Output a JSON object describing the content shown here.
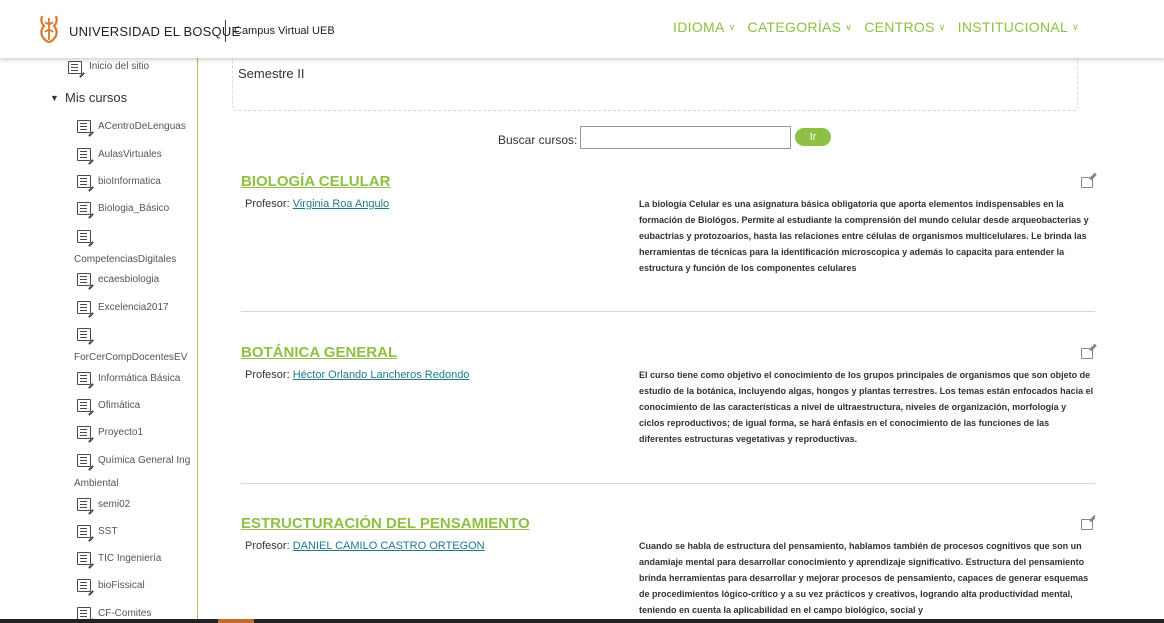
{
  "header": {
    "university": "UNIVERSIDAD EL BOSQUE",
    "campus": "Campus Virtual UEB",
    "nav": [
      "IDIOMA",
      "CATEGORÍAS",
      "CENTROS",
      "INSTITUCIONAL"
    ],
    "accent_color": "#8dc043"
  },
  "sidebar": {
    "top_item": "Inicio del sitio",
    "section": "Mis cursos",
    "courses": [
      "ACentroDeLenguas",
      "AulasVirtuales",
      "bioInformatica",
      "Biologia_Básico",
      "CompetenciasDigitales",
      "ecaesbiologia",
      "Excelencia2017",
      "ForCerCompDocentesEV",
      "Informática Básica",
      "Ofimática",
      "Proyecto1",
      "Química General Ing",
      "Ambiental",
      "semi02",
      "SST",
      "TIC Ingeniería",
      "bioFissical",
      "CF-Comites"
    ]
  },
  "main": {
    "semestre": "Semestre II",
    "search_label": "Buscar cursos:",
    "search_button": "Ir",
    "courses": [
      {
        "title": "BIOLOGÍA CELULAR",
        "prof_label": "Profesor:",
        "prof_name": "Virginia Roa Angulo",
        "description": "La biología Celular es una asignatura básica obligatoria que aporta elementos indispensables en la formación de Biológos. Permite al estudiante la comprensión del mundo celular desde arqueobacterias y eubactrias y protozoarios, hasta las relaciones entre células de organismos multicelulares. Le brinda las herramientas de técnicas para la identificación microscopica y además lo capacita para entender la estructura y función de los componentes celulares"
      },
      {
        "title": "BOTÁNICA GENERAL",
        "prof_label": "Profesor:",
        "prof_name": "Héctor Orlando Lancheros Redondo",
        "description": "El curso tiene como objetivo el conocimiento de los grupos principales de organismos que son objeto de estudio de la botánica, incluyendo algas, hongos y plantas terrestres. Los temas están enfocados hacia el conocimiento de las características a nivel de ultraestructura, niveles de organización, morfología y ciclos reproductivos; de igual forma, se hará énfasis en el conocimiento de las funciones de las diferentes estructuras vegetativas y reproductivas."
      },
      {
        "title": "ESTRUCTURACIÓN DEL PENSAMIENTO",
        "prof_label": "Profesor:",
        "prof_name": "DANIEL CAMILO CASTRO ORTEGON",
        "description": "Cuando se habla de estructura del pensamiento, hablamos también de procesos cognitivos que son un andamiaje mental para desarrollar conocimiento y aprendizaje significativo.  Estructura del pensamiento brinda herramientas para desarrollar y mejorar procesos de pensamiento, capaces de  generar esquemas de procedimientos lógico-crítico y a su vez prácticos y creativos, logrando alta productividad mental, teniendo en cuenta la aplicabilidad en el campo biológico, social y"
      }
    ]
  }
}
